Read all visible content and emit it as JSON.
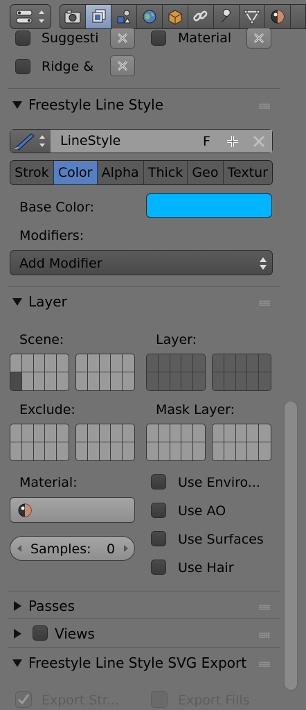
{
  "header": {
    "tabs": [
      "render-icon",
      "render-layers-icon",
      "scene-icon",
      "world-icon",
      "object-icon",
      "constraints-icon",
      "modifier-icon",
      "data-icon",
      "material-icon"
    ],
    "active_tab": 1
  },
  "top_partial": {
    "items": [
      {
        "label": "Suggesti"
      },
      {
        "label": "Material"
      },
      {
        "label": "Ridge &"
      }
    ]
  },
  "freestyle_line_style": {
    "title": "Freestyle Line Style",
    "linestyle_name": "LineStyle",
    "fake_user_label": "F",
    "tabs": [
      "Strok",
      "Color",
      "Alpha",
      "Thick",
      "Geo",
      "Textur"
    ],
    "active_tab": "Color",
    "base_color_label": "Base Color:",
    "base_color_value": "#00b4ff",
    "modifiers_label": "Modifiers:",
    "add_modifier_label": "Add Modifier"
  },
  "layer": {
    "title": "Layer",
    "scene_label": "Scene:",
    "layer_label": "Layer:",
    "exclude_label": "Exclude:",
    "mask_layer_label": "Mask Layer:",
    "material_label": "Material:",
    "samples_label": "Samples:",
    "samples_value": "0",
    "options": [
      {
        "label": "Use Enviro..."
      },
      {
        "label": "Use AO"
      },
      {
        "label": "Use Surfaces"
      },
      {
        "label": "Use Hair"
      }
    ]
  },
  "passes": {
    "title": "Passes"
  },
  "views": {
    "title": "Views"
  },
  "svg_export": {
    "title": "Freestyle Line Style SVG Export",
    "export_strokes_label": "Export Str...",
    "export_fills_label": "Export Fills"
  }
}
